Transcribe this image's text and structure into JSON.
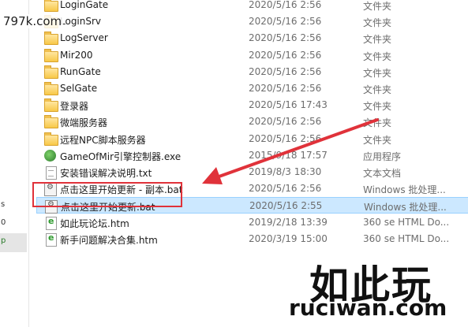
{
  "watermark": {
    "top_text": "797k.com",
    "logo_text": "如此玩",
    "domain_text": "ruciwan.com"
  },
  "nav": {
    "glyphs": [
      "s",
      "0",
      "p"
    ]
  },
  "files": [
    {
      "name": "LoginGate",
      "date": "2020/5/16 2:56",
      "type": "文件夹",
      "icon": "folder-icon"
    },
    {
      "name": "LoginSrv",
      "date": "2020/5/16 2:56",
      "type": "文件夹",
      "icon": "folder-icon"
    },
    {
      "name": "LogServer",
      "date": "2020/5/16 2:56",
      "type": "文件夹",
      "icon": "folder-icon"
    },
    {
      "name": "Mir200",
      "date": "2020/5/16 2:56",
      "type": "文件夹",
      "icon": "folder-icon"
    },
    {
      "name": "RunGate",
      "date": "2020/5/16 2:56",
      "type": "文件夹",
      "icon": "folder-icon"
    },
    {
      "name": "SelGate",
      "date": "2020/5/16 2:56",
      "type": "文件夹",
      "icon": "folder-icon"
    },
    {
      "name": "登录器",
      "date": "2020/5/16 17:43",
      "type": "文件夹",
      "icon": "folder-icon"
    },
    {
      "name": "微端服务器",
      "date": "2020/5/16 2:56",
      "type": "文件夹",
      "icon": "folder-icon"
    },
    {
      "name": "远程NPC脚本服务器",
      "date": "2020/5/16 2:56",
      "type": "文件夹",
      "icon": "folder-icon"
    },
    {
      "name": "GameOfMir引擎控制器.exe",
      "date": "2015/9/18 17:57",
      "type": "应用程序",
      "icon": "exe-icon"
    },
    {
      "name": "安装错误解决说明.txt",
      "date": "2019/8/3 18:30",
      "type": "文本文档",
      "icon": "doc-icon"
    },
    {
      "name": "点击这里开始更新 - 副本.bat",
      "date": "2020/5/16 2:56",
      "type": "Windows 批处理...",
      "icon": "bat-icon"
    },
    {
      "name": "点击这里开始更新.bat",
      "date": "2020/5/16 2:55",
      "type": "Windows 批处理...",
      "icon": "bat-icon",
      "selected": true
    },
    {
      "name": "如此玩论坛.htm",
      "date": "2019/2/18 13:39",
      "type": "360 se HTML Do...",
      "icon": "html-icon"
    },
    {
      "name": "新手问题解决合集.htm",
      "date": "2020/3/19 15:00",
      "type": "360 se HTML Do...",
      "icon": "html-icon"
    }
  ],
  "colors": {
    "selection_bg": "#cce8ff",
    "annotation_red": "#e0323a",
    "folder": "#f8c848"
  }
}
